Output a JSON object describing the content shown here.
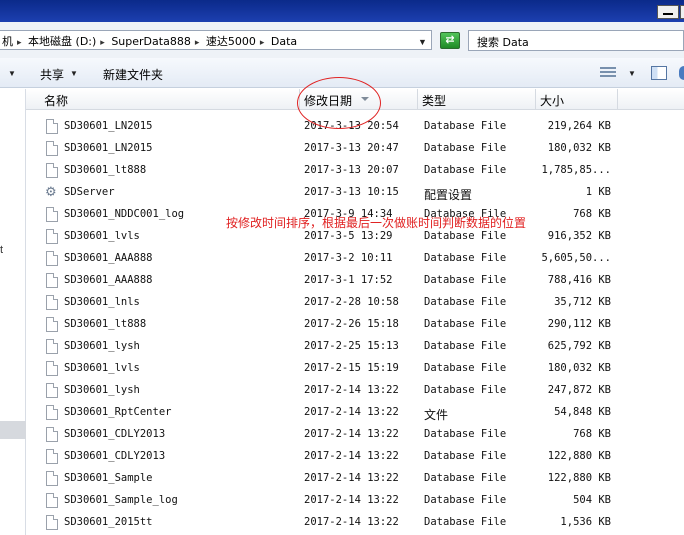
{
  "window": {
    "minimize_label": "minimize",
    "maximize_label": "maximize"
  },
  "address": {
    "breadcrumbs": [
      "机",
      "本地磁盘 (D:)",
      "SuperData888",
      "速达5000",
      "Data"
    ],
    "search_placeholder": "搜索 Data"
  },
  "toolbar": {
    "share_label": "共享",
    "new_folder_label": "新建文件夹"
  },
  "columns": {
    "name": "名称",
    "date": "修改日期",
    "type": "类型",
    "size": "大小"
  },
  "files": [
    {
      "name": "SD30601_LN2015",
      "date": "2017-3-13 20:54",
      "type": "Database File",
      "size": "219,264 KB",
      "icon": "file-icon"
    },
    {
      "name": "SD30601_LN2015",
      "date": "2017-3-13 20:47",
      "type": "Database File",
      "size": "180,032 KB",
      "icon": "file-icon"
    },
    {
      "name": "SD30601_lt888",
      "date": "2017-3-13 20:07",
      "type": "Database File",
      "size": "1,785,85...",
      "icon": "file-icon"
    },
    {
      "name": "SDServer",
      "date": "2017-3-13 10:15",
      "type": "配置设置",
      "size": "1 KB",
      "icon": "gear-file-icon"
    },
    {
      "name": "SD30601_NDDC001_log",
      "date": "2017-3-9 14:34",
      "type": "Database File",
      "size": "768 KB",
      "icon": "file-icon"
    },
    {
      "name": "SD30601_lvls",
      "date": "2017-3-5 13:29",
      "type": "Database File",
      "size": "916,352 KB",
      "icon": "file-icon"
    },
    {
      "name": "SD30601_AAA888",
      "date": "2017-3-2 10:11",
      "type": "Database File",
      "size": "5,605,50...",
      "icon": "file-icon"
    },
    {
      "name": "SD30601_AAA888",
      "date": "2017-3-1 17:52",
      "type": "Database File",
      "size": "788,416 KB",
      "icon": "file-icon"
    },
    {
      "name": "SD30601_lnls",
      "date": "2017-2-28 10:58",
      "type": "Database File",
      "size": "35,712 KB",
      "icon": "file-icon"
    },
    {
      "name": "SD30601_lt888",
      "date": "2017-2-26 15:18",
      "type": "Database File",
      "size": "290,112 KB",
      "icon": "file-icon"
    },
    {
      "name": "SD30601_lysh",
      "date": "2017-2-25 15:13",
      "type": "Database File",
      "size": "625,792 KB",
      "icon": "file-icon"
    },
    {
      "name": "SD30601_lvls",
      "date": "2017-2-15 15:19",
      "type": "Database File",
      "size": "180,032 KB",
      "icon": "file-icon"
    },
    {
      "name": "SD30601_lysh",
      "date": "2017-2-14 13:22",
      "type": "Database File",
      "size": "247,872 KB",
      "icon": "file-icon"
    },
    {
      "name": "SD30601_RptCenter",
      "date": "2017-2-14 13:22",
      "type": "文件",
      "size": "54,848 KB",
      "icon": "file-icon"
    },
    {
      "name": "SD30601_CDLY2013",
      "date": "2017-2-14 13:22",
      "type": "Database File",
      "size": "768 KB",
      "icon": "file-icon"
    },
    {
      "name": "SD30601_CDLY2013",
      "date": "2017-2-14 13:22",
      "type": "Database File",
      "size": "122,880 KB",
      "icon": "file-icon"
    },
    {
      "name": "SD30601_Sample",
      "date": "2017-2-14 13:22",
      "type": "Database File",
      "size": "122,880 KB",
      "icon": "file-icon"
    },
    {
      "name": "SD30601_Sample_log",
      "date": "2017-2-14 13:22",
      "type": "Database File",
      "size": "504 KB",
      "icon": "file-icon"
    },
    {
      "name": "SD30601_2015tt",
      "date": "2017-2-14 13:22",
      "type": "Database File",
      "size": "1,536 KB",
      "icon": "file-icon"
    }
  ],
  "annotation": {
    "text": "按修改时间排序，根据最后一次做账时间判断数据的位置",
    "color": "#e02020"
  },
  "colors": {
    "titlebar": "#0b2a8a",
    "annotation_red": "#e02020",
    "refresh_green": "#2f9e36"
  }
}
